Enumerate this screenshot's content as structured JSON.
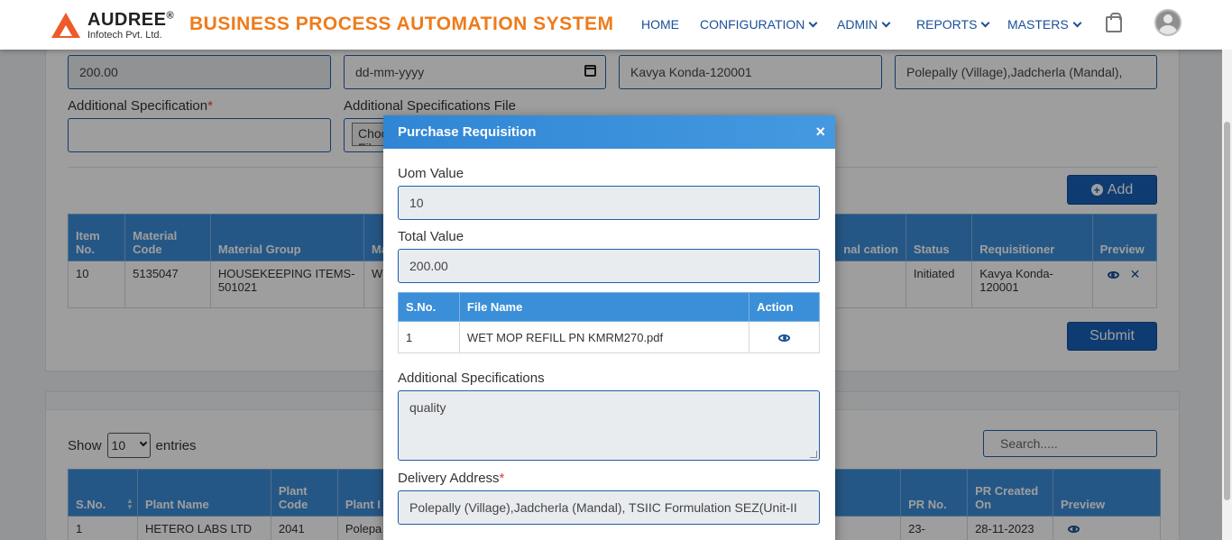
{
  "header": {
    "logo_name": "AUDREE",
    "logo_reg": "®",
    "logo_sub": "Infotech Pvt. Ltd.",
    "system_title": "BUSINESS PROCESS AUTOMATION SYSTEM",
    "nav": [
      {
        "label": "HOME",
        "dropdown": false
      },
      {
        "label": "CONFIGURATION",
        "dropdown": true
      },
      {
        "label": "ADMIN",
        "dropdown": true
      },
      {
        "label": "REPORTS",
        "dropdown": true
      },
      {
        "label": "MASTERS",
        "dropdown": true
      }
    ]
  },
  "form": {
    "total_value": "200.00",
    "date_placeholder": "dd-mm-yyyy",
    "requisitioner": "Kavya  Konda-120001",
    "delivery_address": "Polepally (Village),Jadcherla (Mandal),",
    "additional_spec_label": "Additional Specification",
    "additional_spec_value": "",
    "spec_file_label": "Additional Specifications File",
    "choose_button": "Choose File",
    "add_button": "Add",
    "submit_button": "Submit"
  },
  "items_table": {
    "headers": [
      "Item No.",
      "Material Code",
      "Material Group",
      "Ma De",
      "nal cation",
      "Status",
      "Requisitioner",
      "Preview"
    ],
    "rows": [
      {
        "item_no": "10",
        "material_code": "5135047",
        "material_group": "HOUSEKEEPING ITEMS-501021",
        "material_desc": "WE KM",
        "status": "Initiated",
        "requisitioner": "Kavya Konda-120001"
      }
    ]
  },
  "list": {
    "show_label": "Show",
    "entries_value": "10",
    "entries_label": "entries",
    "search_placeholder": "Search.....",
    "headers": [
      "S.No.",
      "Plant Name",
      "Plant Code",
      "Plant I",
      "PR No.",
      "PR Created On",
      "Preview"
    ],
    "rows": [
      {
        "sno": "1",
        "plant_name": "HETERO LABS LTD",
        "plant_code": "2041",
        "plant": "Polepa",
        "pr_no": "23-",
        "created_on": "28-11-2023"
      }
    ]
  },
  "modal": {
    "title": "Purchase Requisition",
    "close": "×",
    "uom_label": "Uom Value",
    "uom_value": "10",
    "total_label": "Total Value",
    "total_value": "200.00",
    "file_table": {
      "headers": [
        "S.No.",
        "File Name",
        "Action"
      ],
      "rows": [
        {
          "sno": "1",
          "file_name": "WET MOP REFILL PN KMRM270.pdf"
        }
      ]
    },
    "spec_label": "Additional Specifications",
    "spec_value": "quality",
    "delivery_label": "Delivery Address",
    "delivery_value": "Polepally (Village),Jadcherla (Mandal), TSIIC Formulation SEZ(Unit-II"
  },
  "colors": {
    "brand_orange": "#ee7b1a",
    "nav_blue": "#1a4f96",
    "header_blue": "#3b8ed8",
    "button_blue": "#1860b8"
  }
}
